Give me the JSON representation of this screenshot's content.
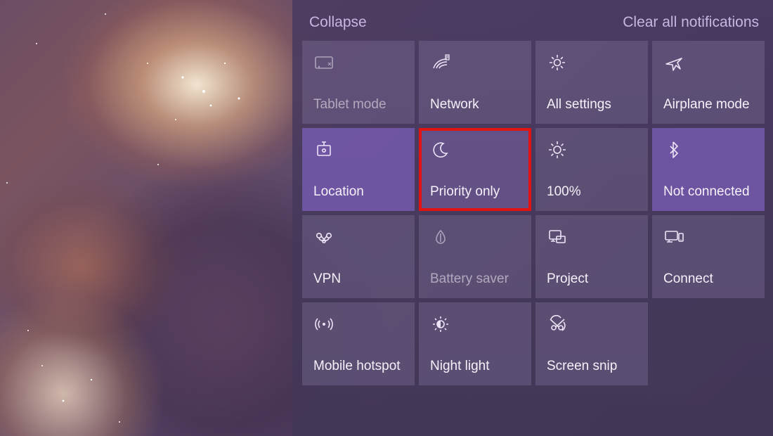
{
  "header": {
    "collapse": "Collapse",
    "clear": "Clear all notifications"
  },
  "tiles": [
    {
      "id": "tablet-mode",
      "label": "Tablet mode",
      "icon": "tablet-mode-icon",
      "state": "dim"
    },
    {
      "id": "network",
      "label": "Network",
      "icon": "network-icon",
      "state": ""
    },
    {
      "id": "all-settings",
      "label": "All settings",
      "icon": "gear-icon",
      "state": ""
    },
    {
      "id": "airplane-mode",
      "label": "Airplane mode",
      "icon": "airplane-icon",
      "state": ""
    },
    {
      "id": "location",
      "label": "Location",
      "icon": "location-icon",
      "state": "active"
    },
    {
      "id": "priority-only",
      "label": "Priority only",
      "icon": "moon-icon",
      "state": "highlight"
    },
    {
      "id": "brightness",
      "label": "100%",
      "icon": "brightness-icon",
      "state": ""
    },
    {
      "id": "bluetooth",
      "label": "Not connected",
      "icon": "bluetooth-icon",
      "state": "active"
    },
    {
      "id": "vpn",
      "label": "VPN",
      "icon": "vpn-icon",
      "state": ""
    },
    {
      "id": "battery-saver",
      "label": "Battery saver",
      "icon": "battery-saver-icon",
      "state": "dim"
    },
    {
      "id": "project",
      "label": "Project",
      "icon": "project-icon",
      "state": ""
    },
    {
      "id": "connect",
      "label": "Connect",
      "icon": "connect-icon",
      "state": ""
    },
    {
      "id": "mobile-hotspot",
      "label": "Mobile hotspot",
      "icon": "hotspot-icon",
      "state": ""
    },
    {
      "id": "night-light",
      "label": "Night light",
      "icon": "night-light-icon",
      "state": ""
    },
    {
      "id": "screen-snip",
      "label": "Screen snip",
      "icon": "screen-snip-icon",
      "state": ""
    }
  ]
}
